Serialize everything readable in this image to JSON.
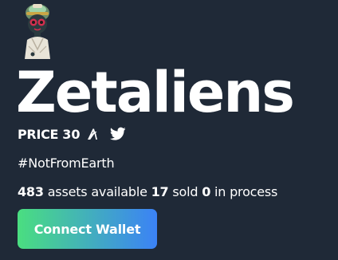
{
  "collection": {
    "title": "Zetaliens",
    "price_label": "PRICE",
    "price_value": "30",
    "currency_icon": "algorand-icon",
    "social_icon": "twitter-icon",
    "hashtag": "#NotFromEarth"
  },
  "stats": {
    "available_count": "483",
    "available_text": " assets available ",
    "sold_count": "17",
    "sold_text": " sold ",
    "in_process_count": "0",
    "in_process_text": " in process"
  },
  "actions": {
    "connect_label": "Connect Wallet"
  },
  "colors": {
    "background": "#1f2937",
    "text": "#ffffff",
    "button_gradient_start": "#4ade80",
    "button_gradient_end": "#3b82f6"
  }
}
